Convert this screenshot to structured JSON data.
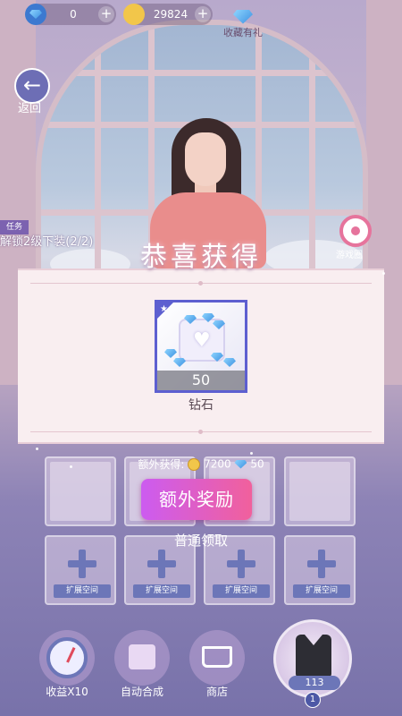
{
  "hud": {
    "diamonds": "0",
    "coins": "29824",
    "collect_label": "收藏有礼"
  },
  "nav": {
    "back_label": "返回",
    "garden_label": "游戏圈"
  },
  "task": {
    "tag": "任务",
    "text": "解锁2级下装(2/2)"
  },
  "reward": {
    "title": "恭喜获得",
    "item_name": "钻石",
    "item_count": "50",
    "extra_label": "额外获得:",
    "extra_coins": "7200",
    "extra_diamonds": "50",
    "bonus_button": "额外奖励",
    "normal_claim": "普通领取"
  },
  "grid": {
    "expand_label": "扩展空间"
  },
  "bottom": {
    "income_label": "收益X10",
    "auto_label": "自动合成",
    "shop_label": "商店",
    "outfit_count": "113",
    "outfit_level": "1"
  },
  "colors": {
    "accent": "#6c76b8",
    "bonus_gradient_start": "#cc5cf0",
    "bonus_gradient_end": "#f1609c",
    "item_border": "#5d5fd0"
  }
}
